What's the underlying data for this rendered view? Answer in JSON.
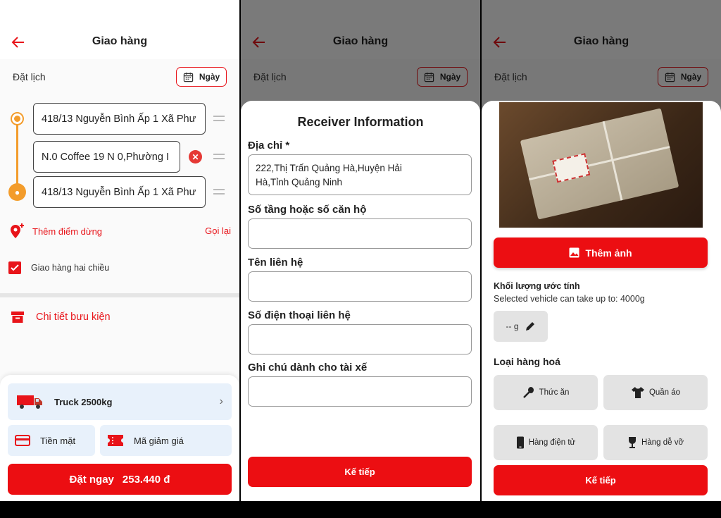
{
  "header": {
    "title": "Giao hàng",
    "schedule_label": "Đặt lịch",
    "date_button": "Ngày"
  },
  "route": {
    "stops": [
      "418/13 Nguyễn Bình Ấp 1 Xã Phư",
      "N.0 Coffee 19 N 0,Phường I",
      "418/13 Nguyễn Bình Ấp 1 Xã Phư"
    ],
    "add_stop": "Thêm điểm dừng",
    "reset": "Gọi lại",
    "two_way": "Giao hàng hai chiều",
    "parcel_details": "Chi tiết bưu kiện"
  },
  "order": {
    "vehicle": "Truck 2500kg",
    "payment": "Tiền mặt",
    "promo": "Mã giảm giá",
    "book_label": "Đặt ngay",
    "price": "253.440 đ"
  },
  "receiver": {
    "title": "Receiver Information",
    "address_label": "Địa chỉ *",
    "address_value_line1": "222,Thị Trấn Quảng Hà,Huyện Hải",
    "address_value_line2": "Hà,Tỉnh Quảng Ninh",
    "floor_label": "Số tầng hoặc số căn hộ",
    "contact_label": "Tên liên hệ",
    "phone_label": "Số điện thoại liên hệ",
    "note_label": "Ghi chú dành cho tài xế",
    "next": "Kế tiếp"
  },
  "goods": {
    "add_photo": "Thêm ảnh",
    "weight_title": "Khối lượng ước tính",
    "weight_sub": "Selected vehicle can take up to: 4000g",
    "weight_value": "-- g",
    "type_title": "Loại hàng hoá",
    "types": [
      "Thức ăn",
      "Quần áo",
      "Hàng điện tử",
      "Hàng dễ vỡ"
    ],
    "next": "Kế tiếp"
  },
  "colors": {
    "accent": "#ec0e12",
    "route": "#f39c2b",
    "panel": "#e8f1fb"
  }
}
